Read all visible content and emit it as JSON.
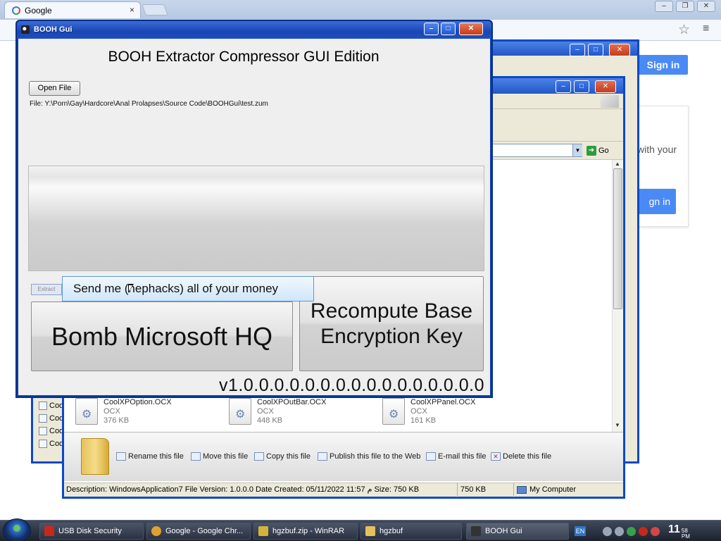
{
  "chrome": {
    "tab_title": "Google",
    "tab_close": "×",
    "window_controls": [
      "–",
      "❐",
      "✕"
    ],
    "sign_in_top": "Sign in",
    "card_text": "with your",
    "card_button": "gn in"
  },
  "explorer": {
    "go_label": "Go",
    "tree_items": [
      "Coo",
      "Coo",
      "Coo",
      "Coo"
    ],
    "files": [
      {
        "name": "CoolXPOption.OCX",
        "type": "OCX",
        "size": "376 KB"
      },
      {
        "name": "CoolXPOutBar.OCX",
        "type": "OCX",
        "size": "448 KB"
      },
      {
        "name": "CoolXPPanel.OCX",
        "type": "OCX",
        "size": "161 KB"
      }
    ],
    "tasks": [
      "Rename this file",
      "Move this file",
      "Copy this file",
      "Publish this file to the Web",
      "E-mail this file",
      "Delete this file"
    ],
    "status": {
      "description": "Description: WindowsApplication7 File Version: 1.0.0.0 Date Created: 05/11/2022 11:57 م Size: 750 KB",
      "size": "750 KB",
      "location": "My Computer"
    }
  },
  "booh": {
    "title": "BOOH Gui",
    "heading": "BOOH Extractor Compressor GUI Edition",
    "open_file": "Open File",
    "file_path": "File: Y:\\Porn\\Gay\\Hardcore\\Anal Prolapses\\Source Code\\BOOHGui\\test.zum",
    "extract": "Extract",
    "tooltip": "Send me (nephacks) all of your money",
    "bomb_button": "Bomb Microsoft HQ",
    "recompute_button": "Recompute Base Encryption Key",
    "version": "v1.0.0.0.0.0.0.0.0.0.0.0.0.0.0.0.0"
  },
  "taskbar": {
    "items": [
      {
        "label": "USB Disk Security",
        "icon_color": "#c8281a"
      },
      {
        "label": "Google - Google Chr...",
        "icon_color": "#e0a030"
      },
      {
        "label": "hgzbuf.zip - WinRAR",
        "icon_color": "#d6b33a"
      },
      {
        "label": "hgzbuf",
        "icon_color": "#e6c15b"
      },
      {
        "label": "BOOH Gui",
        "icon_color": "#333333"
      }
    ],
    "lang": "EN",
    "clock_hour": "11",
    "clock_min": "58",
    "clock_ampm": "PM"
  }
}
